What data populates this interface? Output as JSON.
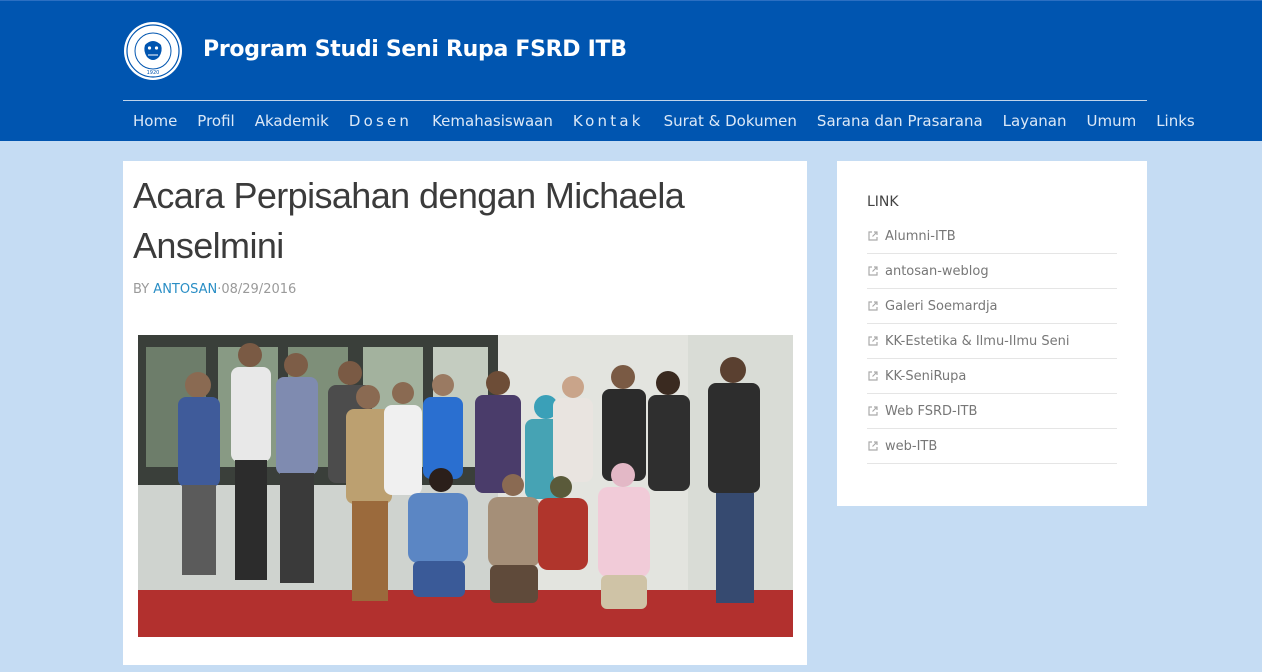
{
  "header": {
    "site_title": "Program Studi Seni Rupa FSRD ITB",
    "logo_icon": "itb-seal-icon",
    "logo_year": "1920",
    "colors": {
      "header_bg": "#0055b0",
      "page_bg": "#c5dcf3",
      "link_accent": "#2a8ec5"
    }
  },
  "nav": {
    "items": [
      {
        "label": "Home"
      },
      {
        "label": "Profil"
      },
      {
        "label": "Akademik"
      },
      {
        "label": "Dosen"
      },
      {
        "label": "Kemahasiswaan"
      },
      {
        "label": "Kontak"
      },
      {
        "label": "Surat & Dokumen"
      },
      {
        "label": "Sarana dan Prasarana"
      },
      {
        "label": "Layanan"
      },
      {
        "label": "Umum"
      },
      {
        "label": "Links"
      }
    ]
  },
  "post": {
    "title": "Acara Perpisahan dengan Michaela Anselmini",
    "by_label": "BY",
    "author": "ANTOSAN",
    "separator": "·",
    "date": "08/29/2016"
  },
  "sidebar": {
    "widget_title": "LINK",
    "link_icon": "external-link-icon",
    "links": [
      {
        "label": "Alumni-ITB"
      },
      {
        "label": "antosan-weblog"
      },
      {
        "label": "Galeri Soemardja"
      },
      {
        "label": "KK-Estetika & Ilmu-Ilmu Seni"
      },
      {
        "label": "KK-SeniRupa"
      },
      {
        "label": "Web FSRD-ITB"
      },
      {
        "label": "web-ITB"
      }
    ]
  }
}
